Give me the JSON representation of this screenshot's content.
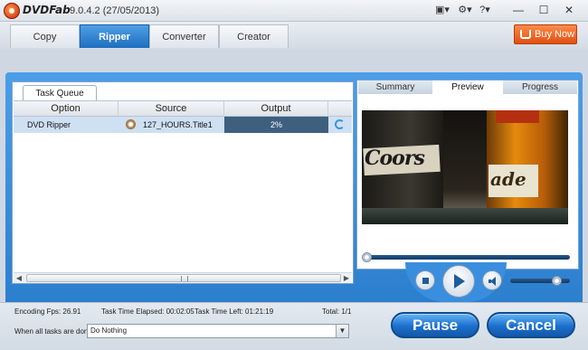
{
  "titlebar": {
    "app_name": "DVDFab",
    "version": "9.0.4.2 (27/05/2013)",
    "buttons": {
      "skin": "▣▾",
      "settings": "⚙▾",
      "help": "?▾",
      "minimize": "—",
      "maximize": "☐",
      "close": "✕"
    }
  },
  "tabs": [
    {
      "label": "Copy",
      "active": false
    },
    {
      "label": "Ripper",
      "active": true
    },
    {
      "label": "Converter",
      "active": false
    },
    {
      "label": "Creator",
      "active": false
    }
  ],
  "buy_button": {
    "label": "Buy Now"
  },
  "task_queue": {
    "tab_label": "Task Queue",
    "columns": [
      "Option",
      "Source",
      "Output"
    ],
    "rows": [
      {
        "option": "DVD Ripper",
        "source": "127_HOURS.Title1",
        "output": "2%"
      }
    ]
  },
  "preview": {
    "tabs": [
      {
        "label": "Summary",
        "active": false
      },
      {
        "label": "Preview",
        "active": true
      },
      {
        "label": "Progress",
        "active": false
      }
    ],
    "frame_text_left": "Coors",
    "frame_text_right": "ade"
  },
  "status": {
    "encoding_fps": "Encoding Fps: 26.91",
    "elapsed": "Task Time Elapsed: 00:02:05",
    "left": "Task Time Left: 01:21:19",
    "total": "Total: 1/1",
    "when_done_label": "When all tasks are done:",
    "when_done_value": "Do Nothing"
  },
  "actions": {
    "pause": "Pause",
    "cancel": "Cancel"
  },
  "icons": {
    "logo": "dvdfab-logo-icon",
    "cart": "cart-icon",
    "disc": "disc-icon",
    "refresh": "refresh-icon",
    "stop": "stop-icon",
    "play": "play-icon",
    "volume": "speaker-icon"
  },
  "colors": {
    "accent": "#2679c8",
    "buy": "#e05010",
    "progress_cell": "#3e607f"
  }
}
